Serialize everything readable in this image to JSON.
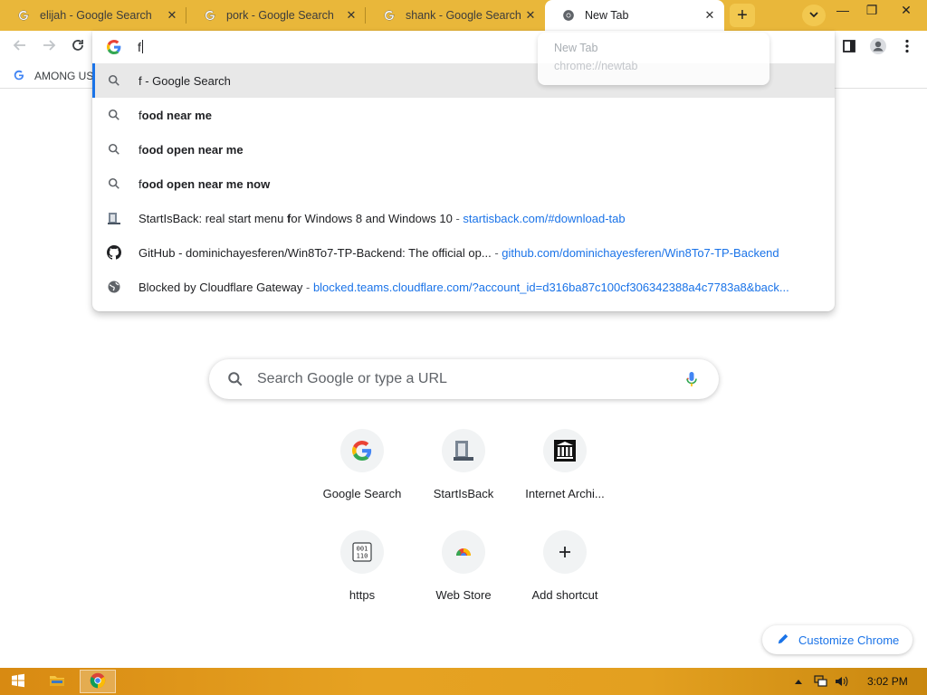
{
  "tabs": [
    {
      "title": "elijah - Google Search",
      "active": false
    },
    {
      "title": "pork - Google Search",
      "active": false
    },
    {
      "title": "shank - Google Search",
      "active": false
    },
    {
      "title": "New Tab",
      "active": true
    }
  ],
  "window_controls": {
    "minimize": "—",
    "restore": "❐",
    "close": "✕"
  },
  "new_tab_symbol": "+",
  "bookmarks": [
    {
      "label": "AMONG US"
    }
  ],
  "omnibox": {
    "text": "f"
  },
  "suggestions": [
    {
      "icon": "search-icon",
      "text_bold": "",
      "text_normal": "f - Google Search",
      "selected": true
    },
    {
      "icon": "search-icon",
      "prefix": "f",
      "rest": "ood near me"
    },
    {
      "icon": "search-icon",
      "prefix": "f",
      "rest": "ood open near me"
    },
    {
      "icon": "search-icon",
      "prefix": "f",
      "rest": "ood open near me now"
    },
    {
      "icon": "startisback-icon",
      "pre": "StartIsBack: real start menu ",
      "match": "f",
      "post": "or Windows 8 and Windows 10",
      "url": "startisback.com/#download-tab"
    },
    {
      "icon": "github-icon",
      "title": "GitHub - dominichayesferen/Win8To7-TP-Backend: The official op...",
      "url": "github.com/dominichayesferen/Win8To7-TP-Backend"
    },
    {
      "icon": "globe-icon",
      "title": "Blocked by Cloudflare Gateway",
      "url": "blocked.teams.cloudflare.com/?account_id=d316ba87c100cf306342388a4c7783a8&back..."
    }
  ],
  "separator": " - ",
  "hover_card": {
    "title": "New Tab",
    "url": "chrome://newtab"
  },
  "ntp": {
    "search_placeholder": "Search Google or type a URL",
    "shortcuts": [
      {
        "label": "Google Search",
        "icon": "google-icon"
      },
      {
        "label": "StartIsBack",
        "icon": "startisback-icon"
      },
      {
        "label": "Internet Archi...",
        "icon": "archive-icon"
      },
      {
        "label": "https",
        "icon": "binary-icon"
      },
      {
        "label": "Web Store",
        "icon": "webstore-icon"
      },
      {
        "label": "Add shortcut",
        "icon": "plus-icon"
      }
    ],
    "customize_label": "Customize Chrome"
  },
  "taskbar": {
    "clock": "3:02 PM"
  },
  "colors": {
    "tab_strip": "#e9b73a",
    "accent": "#1a73e8",
    "taskbar": "#e6a222"
  }
}
